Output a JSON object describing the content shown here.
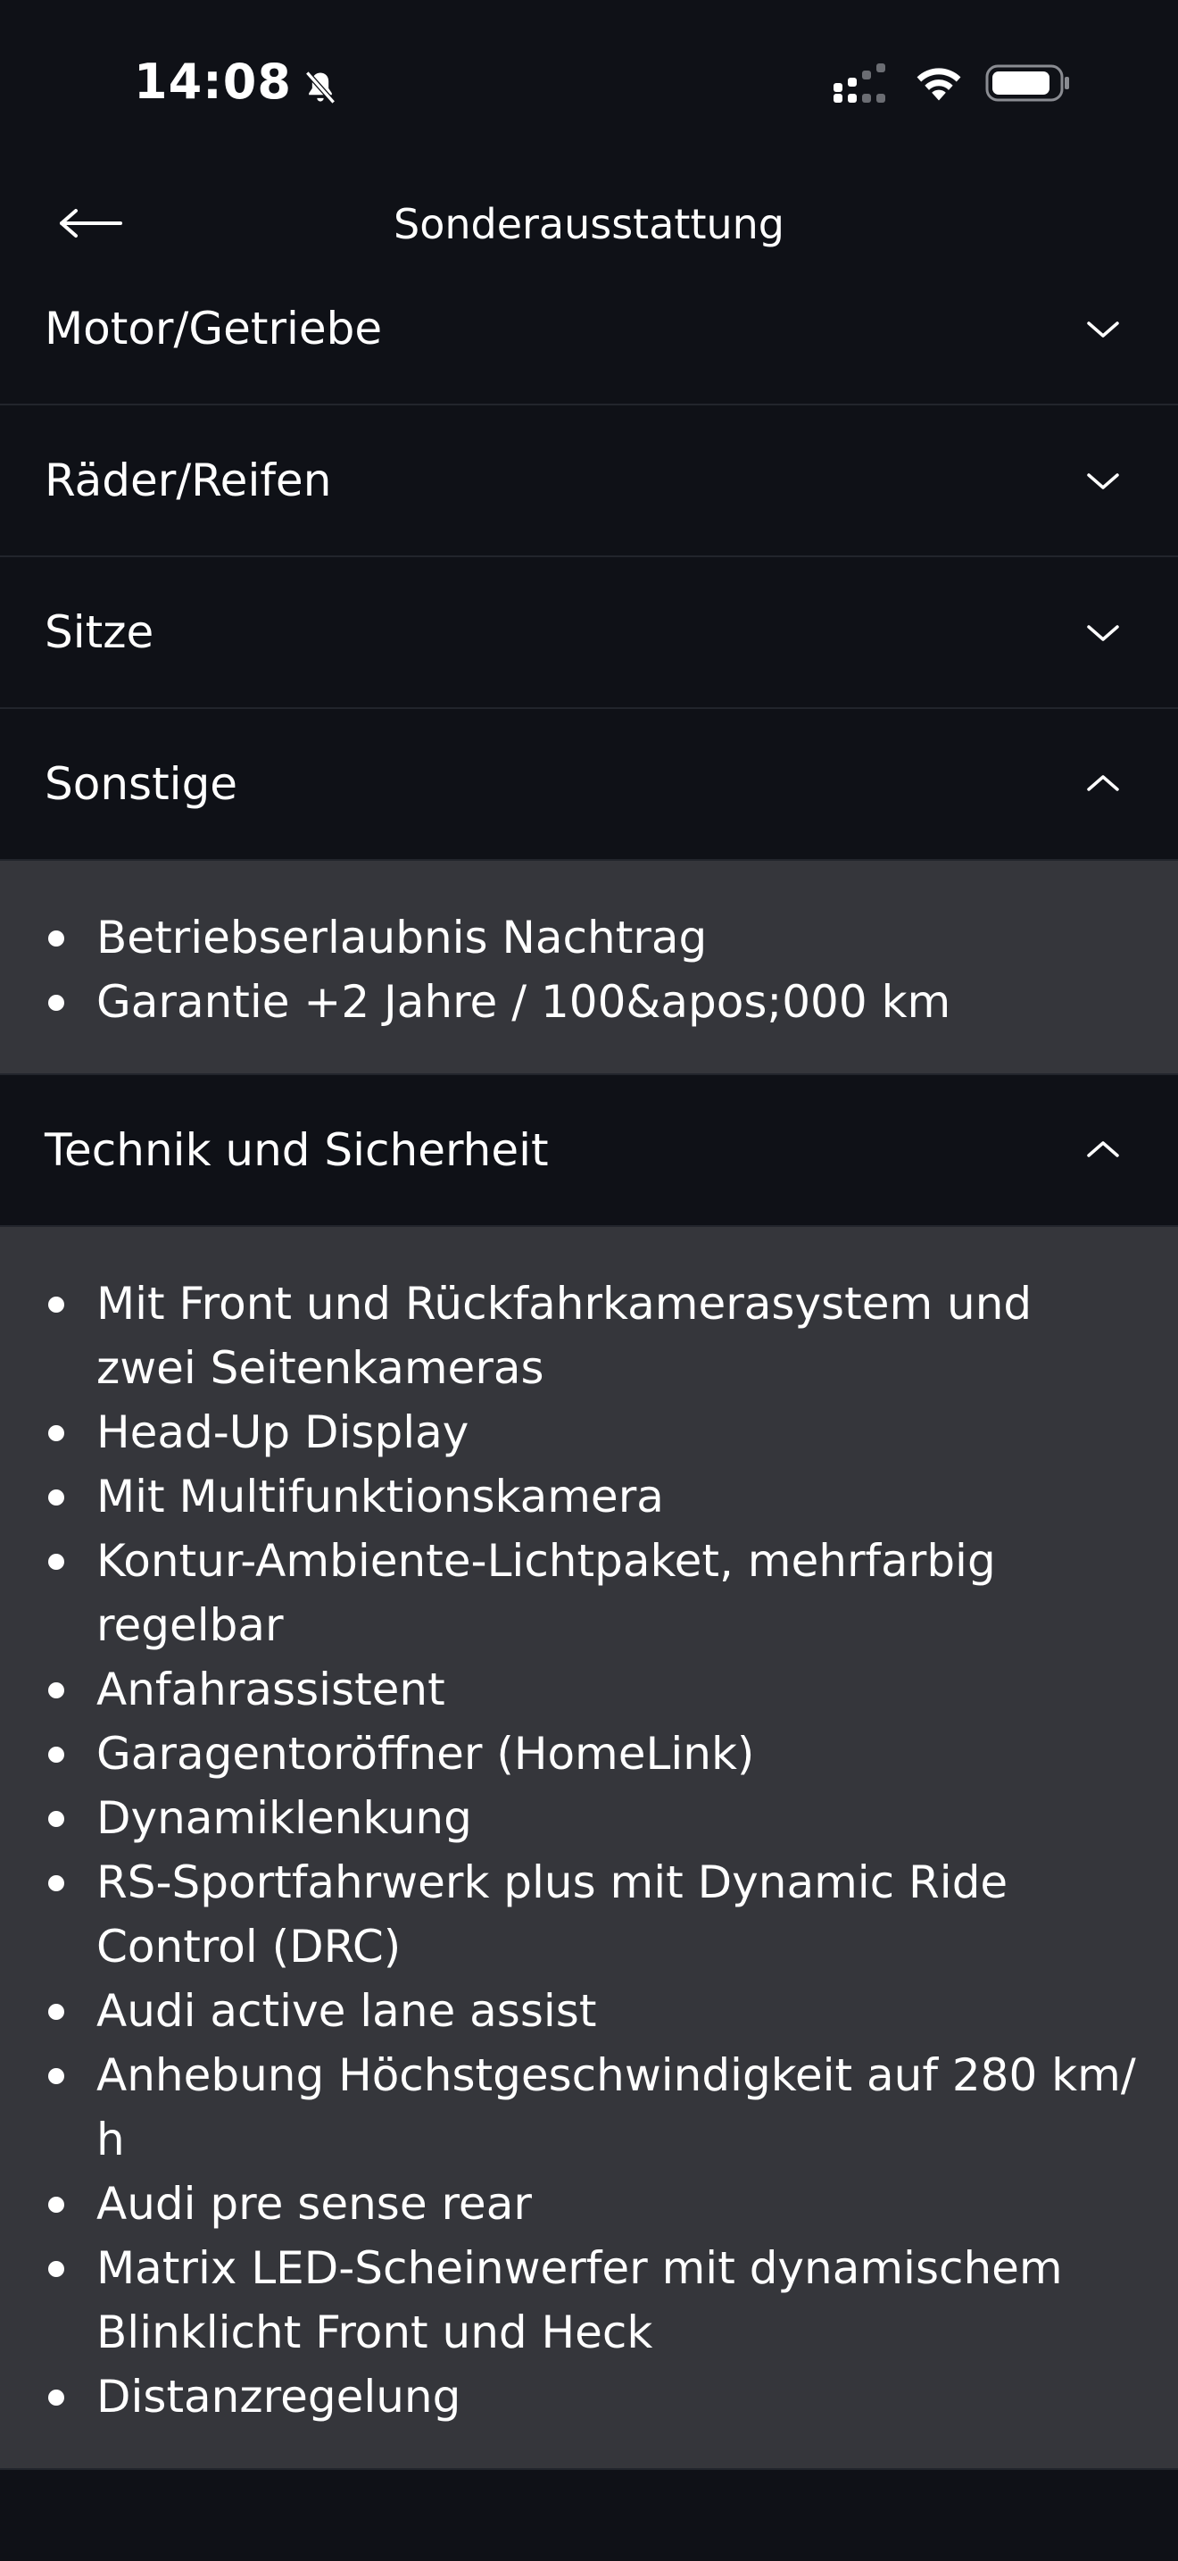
{
  "status_bar": {
    "time": "14:08"
  },
  "header": {
    "title": "Sonderausstattung"
  },
  "sections": [
    {
      "label": "Motor/Getriebe",
      "expanded": false
    },
    {
      "label": "Räder/Reifen",
      "expanded": false
    },
    {
      "label": "Sitze",
      "expanded": false
    },
    {
      "label": "Sonstige",
      "expanded": true,
      "items": [
        "Betriebserlaubnis Nachtrag",
        "Garantie +2 Jahre / 100&apos;000 km"
      ]
    },
    {
      "label": "Technik und Sicherheit",
      "expanded": true,
      "items": [
        "Mit Front und Rückfahrkamerasystem und zwei Seitenkameras",
        "Head-Up Display",
        "Mit Multifunktionskamera",
        "Kontur-Ambiente-Lichtpaket, mehrfarbig regelbar",
        "Anfahrassistent",
        "Garagentoröffner (HomeLink)",
        "Dynamiklenkung",
        "RS-Sportfahrwerk plus mit Dynamic Ride Control (DRC)",
        "Audi active lane assist",
        "Anhebung Höchstgeschwindigkeit auf 280 km/ h",
        "Audi pre sense rear",
        "Matrix LED-Scheinwerfer mit dynamischem Blinklicht Front und Heck",
        "Distanzregelung"
      ]
    }
  ],
  "icons": {
    "back": "arrow-left-icon",
    "expand": "chevron-down-icon",
    "collapse": "chevron-up-icon",
    "silent": "bell-slash-icon",
    "signal": "cellular-signal-icon",
    "wifi": "wifi-icon",
    "battery": "battery-icon"
  },
  "colors": {
    "background": "#0f1117",
    "panel": "#35363b",
    "divider": "#22252c",
    "text": "#ffffff"
  }
}
